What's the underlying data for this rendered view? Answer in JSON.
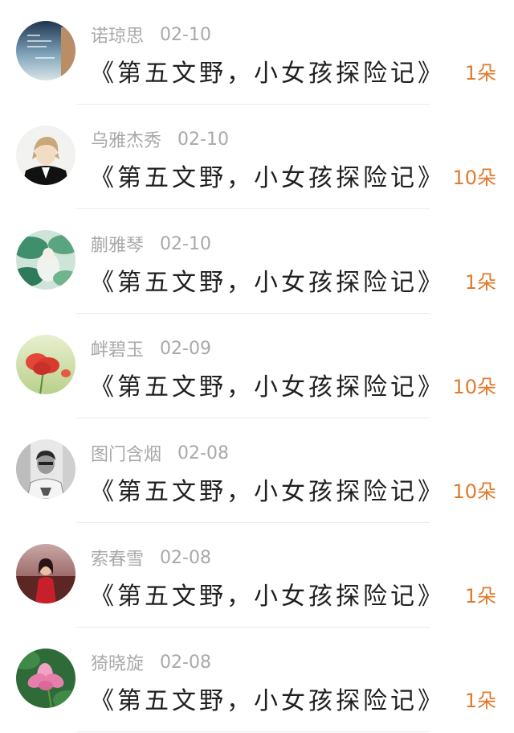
{
  "gift_color": "#e07a2e",
  "entries": [
    {
      "name": "诺琼思",
      "date": "02-10",
      "title": "《第五文野，小女孩探险记》",
      "gift": "1朵",
      "avatar": "text-scenery-avatar"
    },
    {
      "name": "乌雅杰秀",
      "date": "02-10",
      "title": "《第五文野，小女孩探险记》",
      "gift": "10朵",
      "avatar": "anime-boy-avatar"
    },
    {
      "name": "蒯雅琴",
      "date": "02-10",
      "title": "《第五文野，小女孩探险记》",
      "gift": "1朵",
      "avatar": "green-illustration-avatar"
    },
    {
      "name": "衅碧玉",
      "date": "02-09",
      "title": "《第五文野，小女孩探险记》",
      "gift": "10朵",
      "avatar": "poppy-flower-avatar"
    },
    {
      "name": "图门含烟",
      "date": "02-08",
      "title": "《第五文野，小女孩探险记》",
      "gift": "10朵",
      "avatar": "bw-person-avatar"
    },
    {
      "name": "索春雪",
      "date": "02-08",
      "title": "《第五文野，小女孩探险记》",
      "gift": "1朵",
      "avatar": "red-dress-girl-avatar"
    },
    {
      "name": "猗晓旋",
      "date": "02-08",
      "title": "《第五文野，小女孩探险记》",
      "gift": "1朵",
      "avatar": "lotus-flower-avatar"
    }
  ]
}
